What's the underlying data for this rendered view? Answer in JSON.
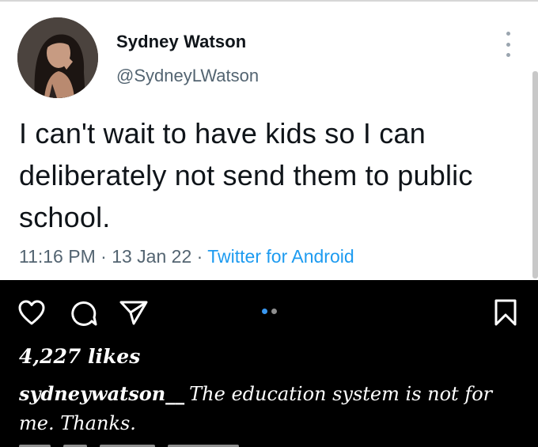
{
  "tweet": {
    "author_name": "Sydney Watson",
    "author_handle": "@SydneyLWatson",
    "text": "I can't wait to have kids so I can deliberately not send them to public school.",
    "time": "11:16 PM",
    "date": "13 Jan 22",
    "separator": "·",
    "source": "Twitter for Android",
    "avatar_icon": "profile-photo",
    "more_icon": "vertical-ellipsis-icon"
  },
  "instagram": {
    "likes": "4,227 likes",
    "caption_user": "sydneywatson__",
    "caption_text": "The education system is not for me. Thanks.",
    "carousel": {
      "active_color": "#3897f0",
      "inactive_color": "#8e8e8e"
    },
    "icons": [
      "heart-icon",
      "comment-icon",
      "share-icon",
      "bookmark-icon"
    ]
  },
  "colors": {
    "tweet_bg": "#ffffff",
    "tweet_text": "#0f1419",
    "tweet_secondary": "#536471",
    "twitter_link": "#1d9bf0",
    "insta_bg": "#000000"
  }
}
